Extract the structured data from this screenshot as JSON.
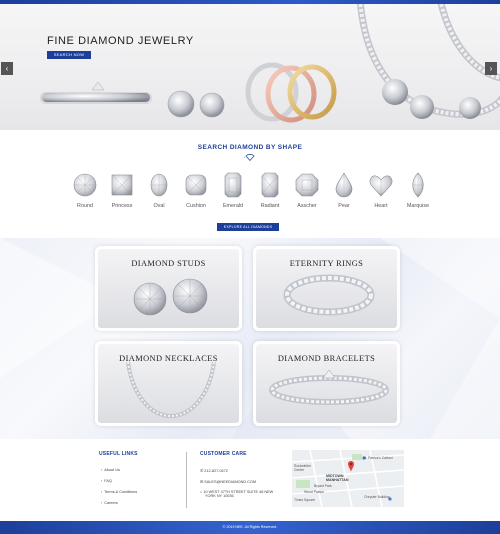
{
  "hero": {
    "title": "FINE DIAMOND JEWELRY",
    "button_label": "SEARCH NOW",
    "prev_arrow": "‹",
    "next_arrow": "›"
  },
  "shapes": {
    "heading": "SEARCH DIAMOND BY SHAPE",
    "items": [
      {
        "label": "Round",
        "icon": "round-diamond-icon"
      },
      {
        "label": "Princess",
        "icon": "princess-diamond-icon"
      },
      {
        "label": "Oval",
        "icon": "oval-diamond-icon"
      },
      {
        "label": "Cushion",
        "icon": "cushion-diamond-icon"
      },
      {
        "label": "Emerald",
        "icon": "emerald-diamond-icon"
      },
      {
        "label": "Radiant",
        "icon": "radiant-diamond-icon"
      },
      {
        "label": "Asscher",
        "icon": "asscher-diamond-icon"
      },
      {
        "label": "Pear",
        "icon": "pear-diamond-icon"
      },
      {
        "label": "Heart",
        "icon": "heart-diamond-icon"
      },
      {
        "label": "Marquise",
        "icon": "marquise-diamond-icon"
      }
    ],
    "explore_label": "EXPLORE ALL DIAMONDS"
  },
  "categories": [
    {
      "title": "DIAMOND STUDS"
    },
    {
      "title": "ETERNITY RINGS"
    },
    {
      "title": "DIAMOND NECKLACES"
    },
    {
      "title": "DIAMOND BRACELETS"
    }
  ],
  "footer": {
    "useful_links_title": "USEFUL LINKS",
    "links": [
      "About Us",
      "FAQ",
      "Terms & Conditions",
      "Careers"
    ],
    "customer_care_title": "CUSTOMER CARE",
    "phone": "212-827-0472",
    "email": "SALES@NEEDIAMOND.COM",
    "address_line1": "10 WEST 47TH STREET SUITE 48 NEW",
    "address_line2": "YORK NY 10036",
    "map_labels": [
      "St. Patrick's Cathed",
      "Rockefeller Center",
      "MIDTOWN MANHATTAN",
      "Bryant Park",
      "Wood Palace",
      "Chrysler Building",
      "Times Square"
    ],
    "copyright": "© 2019 NEE. All Rights Reserved."
  },
  "colors": {
    "brand_blue": "#1d3f9a",
    "map_pin": "#e0463c"
  }
}
